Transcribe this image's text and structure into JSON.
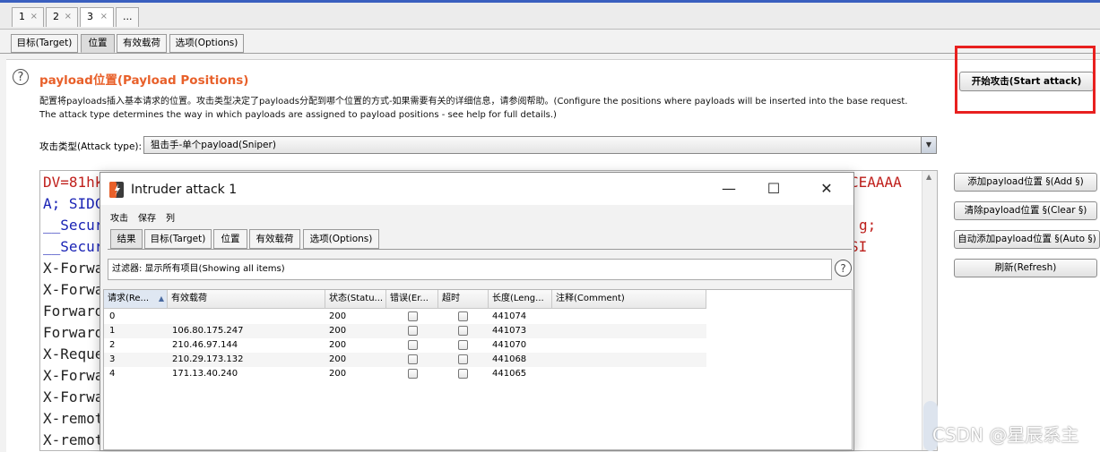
{
  "top_tabs": [
    {
      "label": "1",
      "close": "×"
    },
    {
      "label": "2",
      "close": "×"
    },
    {
      "label": "3",
      "close": "×"
    },
    {
      "label": "..."
    }
  ],
  "sub_tabs": [
    "目标(Target)",
    "位置",
    "有效载荷",
    "选项(Options)"
  ],
  "payload_positions": {
    "help_glyph": "?",
    "title": "payload位置(Payload Positions)",
    "desc_line1": "配置将payloads插入基本请求的位置。攻击类型决定了payloads分配到哪个位置的方式-如果需要有关的详细信息，请参阅帮助。(Configure the positions where payloads will be inserted into the base request.",
    "desc_line2": "The attack type determines the way in which payloads are assigned to payload positions - see help for full details.)",
    "attack_type_label": "攻击类型(Attack type):",
    "attack_type_value": "狙击手-单个payload(Sniper)",
    "select_arrow": "▼"
  },
  "buttons": {
    "start_attack": "开始攻击(Start attack)",
    "add": "添加payload位置 §(Add §)",
    "clear": "清除payload位置 §(Clear §)",
    "auto": "自动添加payload位置 §(Auto §)",
    "refresh": "刷新(Refresh)"
  },
  "request_lines": [
    {
      "left": "DV=81hk",
      "right": "CEAAAA"
    },
    {
      "left": "A; SIDC",
      "right": ""
    },
    {
      "left": "__Secur",
      "right": "g;"
    },
    {
      "left": "__Secur",
      "right": "SI"
    },
    {
      "left": "X-Forwa",
      "right": ""
    },
    {
      "left": "X-Forwa",
      "right": ""
    },
    {
      "left": "Forward",
      "right": ""
    },
    {
      "left": "Forward",
      "right": ""
    },
    {
      "left": "X-Reque",
      "right": ""
    },
    {
      "left": "X-Forwa",
      "right": ""
    },
    {
      "left": "X-Forwa",
      "right": ""
    },
    {
      "left": "X-remot",
      "right": ""
    },
    {
      "left": "X-remot",
      "right": ""
    }
  ],
  "intruder": {
    "title": "Intruder attack 1",
    "controls": {
      "minimize": "—",
      "maximize": "☐",
      "close": "✕"
    },
    "menu": [
      "攻击",
      "保存",
      "列"
    ],
    "tabs": [
      "结果",
      "目标(Target)",
      "位置",
      "有效载荷",
      "选项(Options)"
    ],
    "filter": "过滤器:   显示所有项目(Showing all items)",
    "filter_help": "?",
    "columns": [
      "请求(Re...",
      "有效载荷",
      "状态(Statu...",
      "错误(Er...",
      "超时",
      "长度(Leng...",
      "注释(Comment)"
    ],
    "sort_arrow": "▲",
    "rows": [
      {
        "req": "0",
        "payload": "",
        "status": "200",
        "length": "441074"
      },
      {
        "req": "1",
        "payload": "106.80.175.247",
        "status": "200",
        "length": "441073"
      },
      {
        "req": "2",
        "payload": "210.46.97.144",
        "status": "200",
        "length": "441070"
      },
      {
        "req": "3",
        "payload": "210.29.173.132",
        "status": "200",
        "length": "441068"
      },
      {
        "req": "4",
        "payload": "171.13.40.240",
        "status": "200",
        "length": "441065"
      }
    ]
  },
  "watermark": "CSDN @星辰系主",
  "colors": {
    "accent_title": "#e8602a",
    "highlight": "#e8201f",
    "req_red": "#c0201c",
    "req_blue": "#1a23b5"
  }
}
